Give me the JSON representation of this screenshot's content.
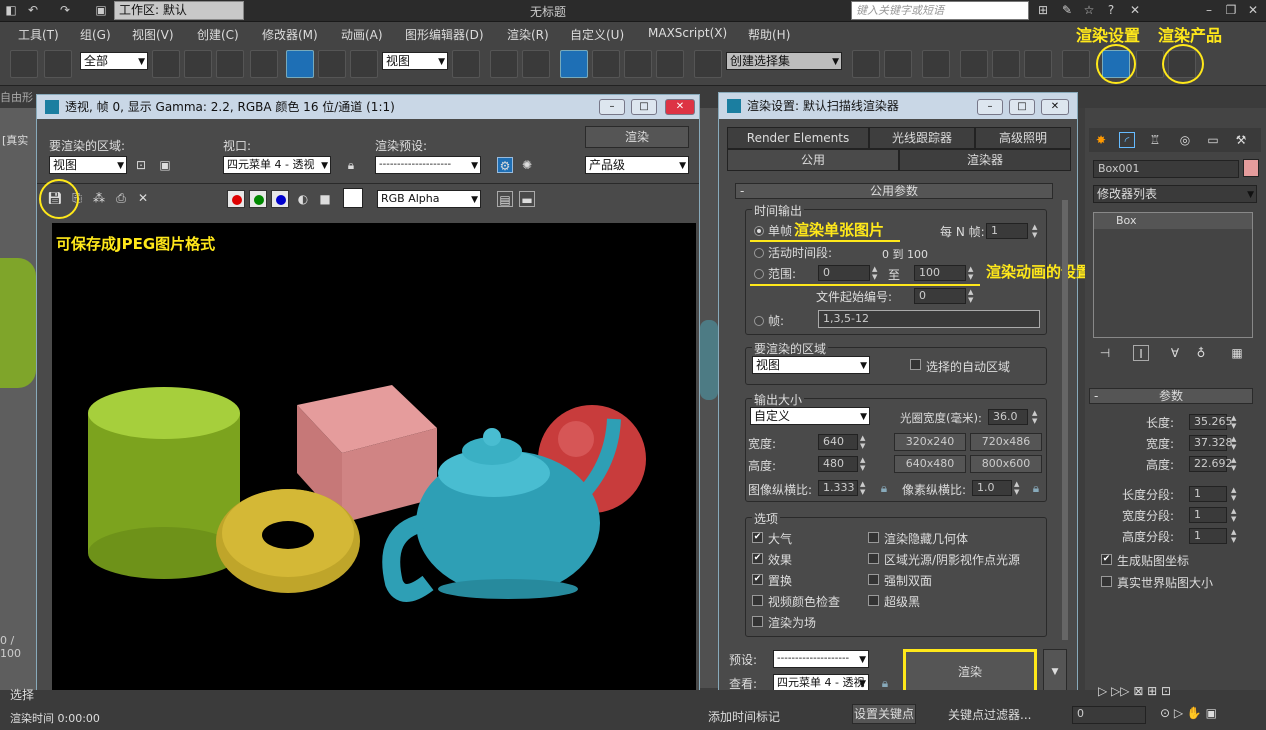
{
  "titlebar": {
    "workspace": "工作区: 默认",
    "title": "无标题",
    "search_placeholder": "键入关键字或短语"
  },
  "menu": [
    "工具(T)",
    "组(G)",
    "视图(V)",
    "创建(C)",
    "修改器(M)",
    "动画(A)",
    "图形编辑器(D)",
    "渲染(R)",
    "自定义(U)",
    "MAXScript(X)",
    "帮助(H)"
  ],
  "toolbar": {
    "filter": "全部",
    "coord": "视图",
    "selset": "创建选择集",
    "annotation_render_setup": "渲染设置",
    "annotation_render_product": "渲染产品"
  },
  "strip": {
    "text": "自由形"
  },
  "left_viewport": {
    "label": "[真实",
    "time": "0 / 100"
  },
  "render_frame": {
    "title": "透视, 帧 0, 显示 Gamma: 2.2, RGBA 颜色 16 位/通道 (1:1)",
    "area_label": "要渲染的区域:",
    "area_value": "视图",
    "viewport_label": "视口:",
    "viewport_value": "四元菜单 4 - 透视",
    "preset_label": "渲染预设:",
    "preset_value": "--------------------",
    "render_button": "渲染",
    "product_value": "产品级",
    "channel_value": "RGB Alpha",
    "annotation_save": "可保存成JPEG图片格式"
  },
  "render_setup": {
    "title": "渲染设置: 默认扫描线渲染器",
    "tabs_row1": [
      "Render Elements",
      "光线跟踪器",
      "高级照明"
    ],
    "tabs_row2": [
      "公用",
      "渲染器"
    ],
    "rollout": "公用参数",
    "time_output": {
      "group": "时间输出",
      "single": "单帧",
      "every_n": "每 N 帧:",
      "every_n_value": "1",
      "active": "活动时间段:",
      "active_range": "0 到 100",
      "range": "范围:",
      "range_from": "0",
      "range_to_label": "至",
      "range_to": "100",
      "file_start": "文件起始编号:",
      "file_start_value": "0",
      "frames": "帧:",
      "frames_value": "1,3,5-12",
      "annotation_single": "渲染单张图片",
      "annotation_anim": "渲染动画的设置"
    },
    "area": {
      "group": "要渲染的区域",
      "value": "视图",
      "auto_region": "选择的自动区域"
    },
    "output_size": {
      "group": "输出大小",
      "preset": "自定义",
      "aperture_label": "光圈宽度(毫米):",
      "aperture_value": "36.0",
      "width_label": "宽度:",
      "width_value": "640",
      "height_label": "高度:",
      "height_value": "480",
      "presets": [
        "320x240",
        "720x486",
        "640x480",
        "800x600"
      ],
      "aspect_label": "图像纵横比:",
      "aspect_value": "1.333",
      "pixel_aspect_label": "像素纵横比:",
      "pixel_aspect_value": "1.0"
    },
    "options": {
      "group": "选项",
      "left": [
        {
          "label": "大气",
          "checked": true
        },
        {
          "label": "效果",
          "checked": true
        },
        {
          "label": "置换",
          "checked": true
        },
        {
          "label": "视频颜色检查",
          "checked": false
        },
        {
          "label": "渲染为场",
          "checked": false
        }
      ],
      "right": [
        {
          "label": "渲染隐藏几何体",
          "checked": false
        },
        {
          "label": "区域光源/阴影视作点光源",
          "checked": false
        },
        {
          "label": "强制双面",
          "checked": false
        },
        {
          "label": "超级黑",
          "checked": false
        }
      ]
    },
    "footer": {
      "preset_label": "预设:",
      "preset_value": "--------------------",
      "view_label": "查看:",
      "view_value": "四元菜单 4 - 透视",
      "render_button": "渲染"
    }
  },
  "command_panel": {
    "object_name": "Box001",
    "modifier_list": "修改器列表",
    "stack_item": "Box",
    "rollout": "参数",
    "params": [
      {
        "label": "长度:",
        "value": "35.265"
      },
      {
        "label": "宽度:",
        "value": "37.328"
      },
      {
        "label": "高度:",
        "value": "22.692"
      }
    ],
    "segs": [
      {
        "label": "长度分段:",
        "value": "1"
      },
      {
        "label": "宽度分段:",
        "value": "1"
      },
      {
        "label": "高度分段:",
        "value": "1"
      }
    ],
    "gen_map": "生成贴图坐标",
    "real_world": "真实世界贴图大小"
  },
  "bottom": {
    "select": "选择",
    "render_time": "渲染时间 0:00:00",
    "add_tag": "添加时间标记",
    "set_key": "设置关键点",
    "key_filter": "关键点过滤器...",
    "frame_value": "0"
  },
  "colors": {
    "annotation": "#ffe81a",
    "accent": "#1e6fb5"
  }
}
